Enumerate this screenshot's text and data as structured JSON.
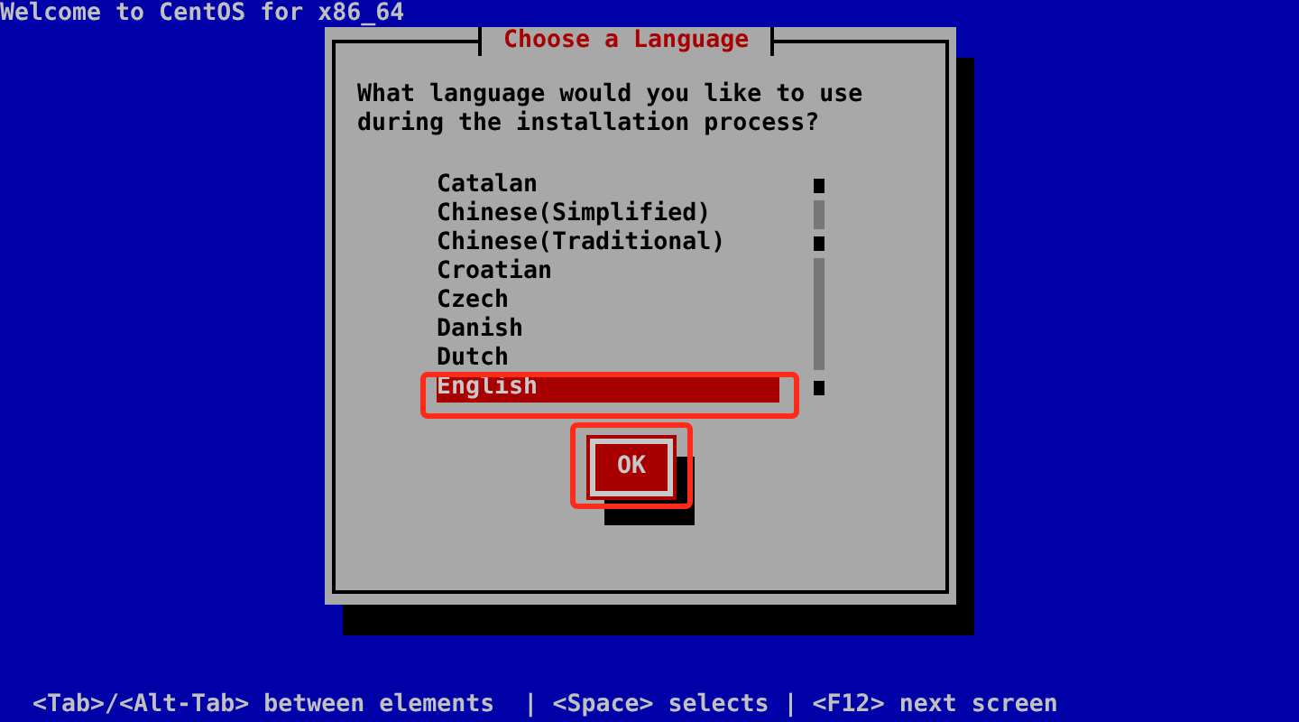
{
  "header": {
    "title": "Welcome to CentOS for x86_64"
  },
  "dialog": {
    "title": "Choose a Language",
    "prompt": "What language would you like to use during the installation process?",
    "languages": [
      {
        "label": "Catalan",
        "selected": false
      },
      {
        "label": "Chinese(Simplified)",
        "selected": false
      },
      {
        "label": "Chinese(Traditional)",
        "selected": false
      },
      {
        "label": "Croatian",
        "selected": false
      },
      {
        "label": "Czech",
        "selected": false
      },
      {
        "label": "Danish",
        "selected": false
      },
      {
        "label": "Dutch",
        "selected": false
      },
      {
        "label": "English",
        "selected": true
      }
    ],
    "buttons": [
      {
        "label": "OK",
        "focused": true
      }
    ]
  },
  "status_bar": "<Tab>/<Alt-Tab> between elements  | <Space> selects | <F12> next screen"
}
